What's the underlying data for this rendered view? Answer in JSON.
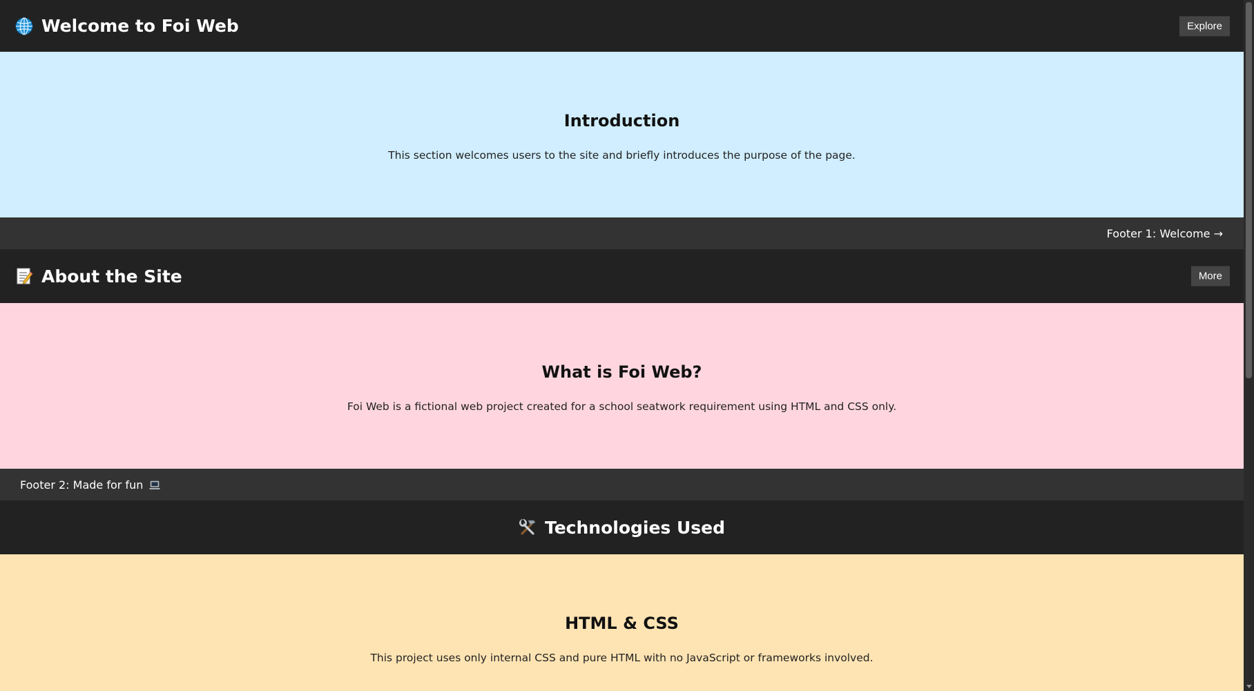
{
  "header1": {
    "title": "Welcome to Foi Web",
    "button": "Explore",
    "icon": "globe-icon"
  },
  "section1": {
    "heading": "Introduction",
    "text": "This section welcomes users to the site and briefly introduces the purpose of the page.",
    "bg": "#d0eeff"
  },
  "footer1": {
    "text": "Footer 1: Welcome →"
  },
  "header2": {
    "title": "About the Site",
    "button": "More",
    "icon": "memo-icon"
  },
  "section2": {
    "heading": "What is Foi Web?",
    "text": "Foi Web is a fictional web project created for a school seatwork requirement using HTML and CSS only.",
    "bg": "#ffd6e0"
  },
  "footer2": {
    "text": "Footer 2: Made for fun",
    "icon": "laptop-icon"
  },
  "header3": {
    "title": "Technologies Used",
    "icon": "tools-icon"
  },
  "section3": {
    "heading": "HTML & CSS",
    "text": "This project uses only internal CSS and pure HTML with no JavaScript or frameworks involved.",
    "bg": "#ffe4b3"
  },
  "colors": {
    "header_bg": "#222222",
    "footer_bg": "#333333",
    "button_bg": "#444444"
  }
}
